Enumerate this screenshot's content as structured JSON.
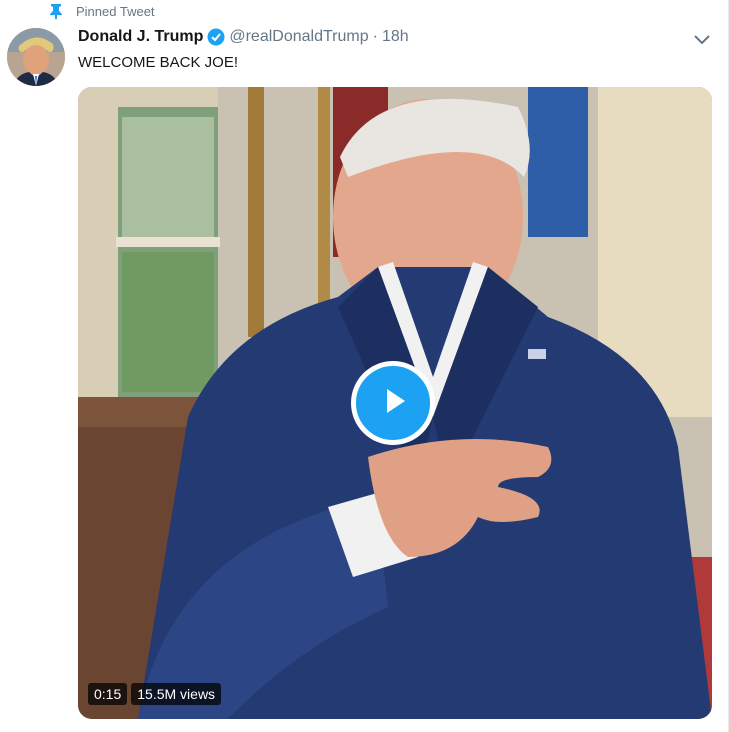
{
  "pinned": {
    "label": "Pinned Tweet",
    "icon": "pin-icon"
  },
  "author": {
    "name": "Donald J. Trump",
    "handle": "@realDonaldTrump",
    "separator": "·",
    "time": "18h",
    "verified_icon": "verified-badge-icon"
  },
  "tweet": {
    "text": "WELCOME BACK JOE!"
  },
  "media": {
    "type": "video",
    "duration": "0:15",
    "views": "15.5M views",
    "play_icon": "play-icon"
  },
  "menu": {
    "icon": "chevron-down-icon"
  },
  "colors": {
    "accent": "#1da1f2",
    "secondary_text": "#657786",
    "primary_text": "#14171a"
  }
}
